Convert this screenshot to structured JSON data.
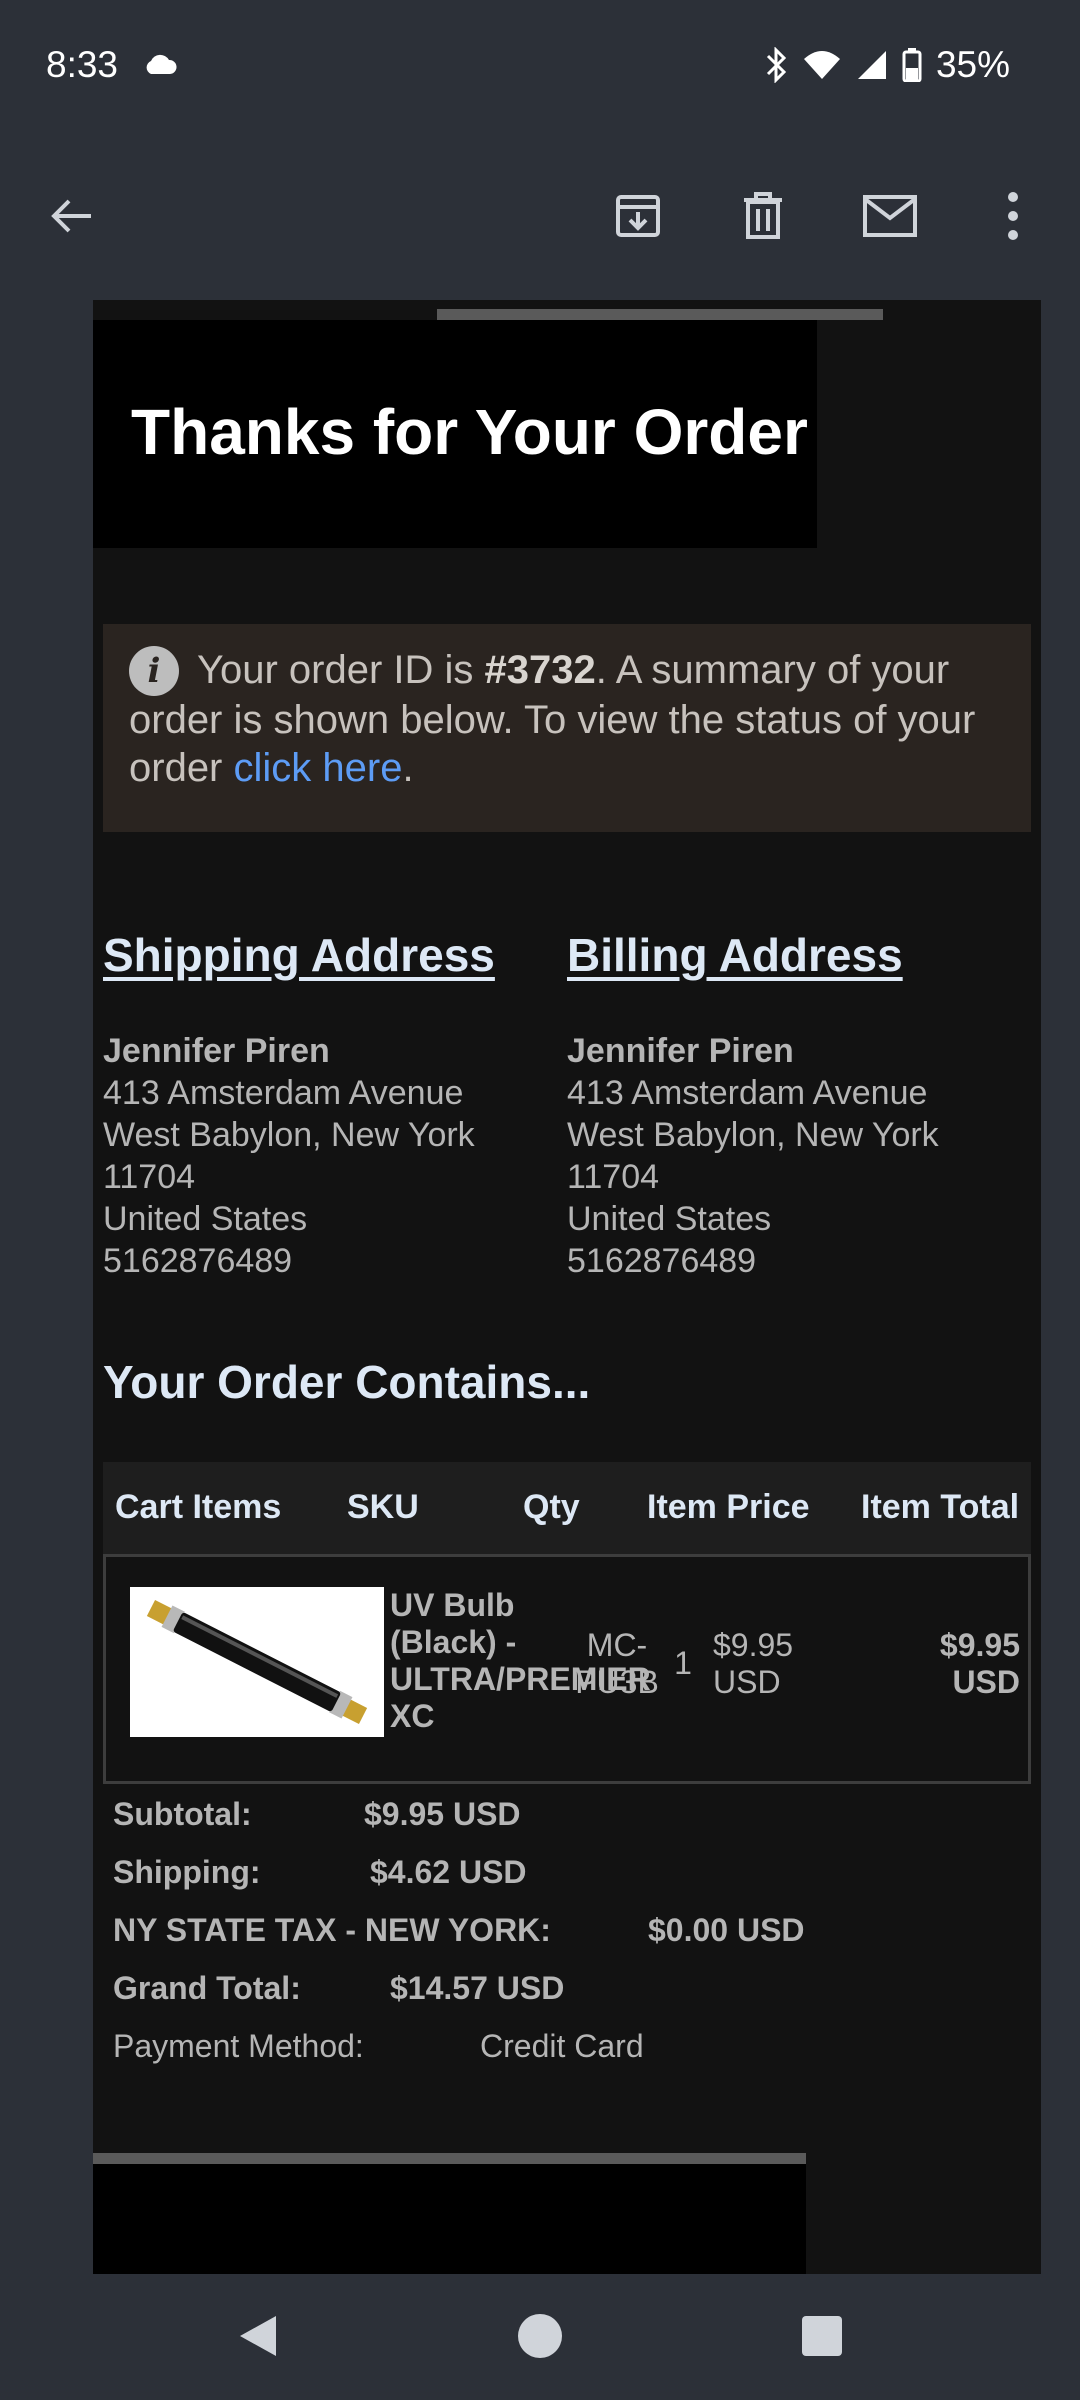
{
  "status_bar": {
    "time": "8:33",
    "battery": "35%"
  },
  "app_bar": {
    "icons": [
      "back-arrow-icon",
      "archive-icon",
      "delete-icon",
      "mail-icon",
      "more-vert-icon"
    ]
  },
  "email": {
    "title": "Thanks for Your Order",
    "info": {
      "prefix": "Your order ID is ",
      "order_id": "#3732",
      "middle": ". A summary of your order is shown below. To view the status of your order ",
      "link": "click here",
      "suffix": "."
    },
    "shipping": {
      "title": "Shipping Address",
      "name": "Jennifer Piren",
      "street": "413 Amsterdam Avenue",
      "city": "West Babylon, New York",
      "zip": "11704",
      "country": "United States",
      "phone": "5162876489"
    },
    "billing": {
      "title": "Billing Address",
      "name": "Jennifer Piren",
      "street": "413 Amsterdam Avenue",
      "city": "West Babylon, New York",
      "zip": "11704",
      "country": "United States",
      "phone": "5162876489"
    },
    "order_title": "Your Order Contains...",
    "table": {
      "headers": [
        "Cart Items",
        "SKU",
        "Qty",
        "Item Price",
        "Item Total"
      ],
      "row": {
        "item": "UV Bulb (Black) - ULTRA/PREMIER XC",
        "sku": "MC-PU3B",
        "qty": "1",
        "price": "$9.95 USD",
        "total": "$9.95 USD"
      }
    },
    "totals": {
      "subtotal_label": "Subtotal:",
      "subtotal": "$9.95 USD",
      "shipping_label": "Shipping:",
      "shipping": "$4.62 USD",
      "tax_label": "NY STATE TAX - NEW YORK:",
      "tax": "$0.00 USD",
      "grand_label": "Grand Total:",
      "grand": "$14.57 USD",
      "payment_label": "Payment Method:",
      "payment": "Credit Card"
    }
  },
  "colors": {
    "link": "#5d9cf5",
    "background": "#121212",
    "chrome": "#2c3038"
  }
}
